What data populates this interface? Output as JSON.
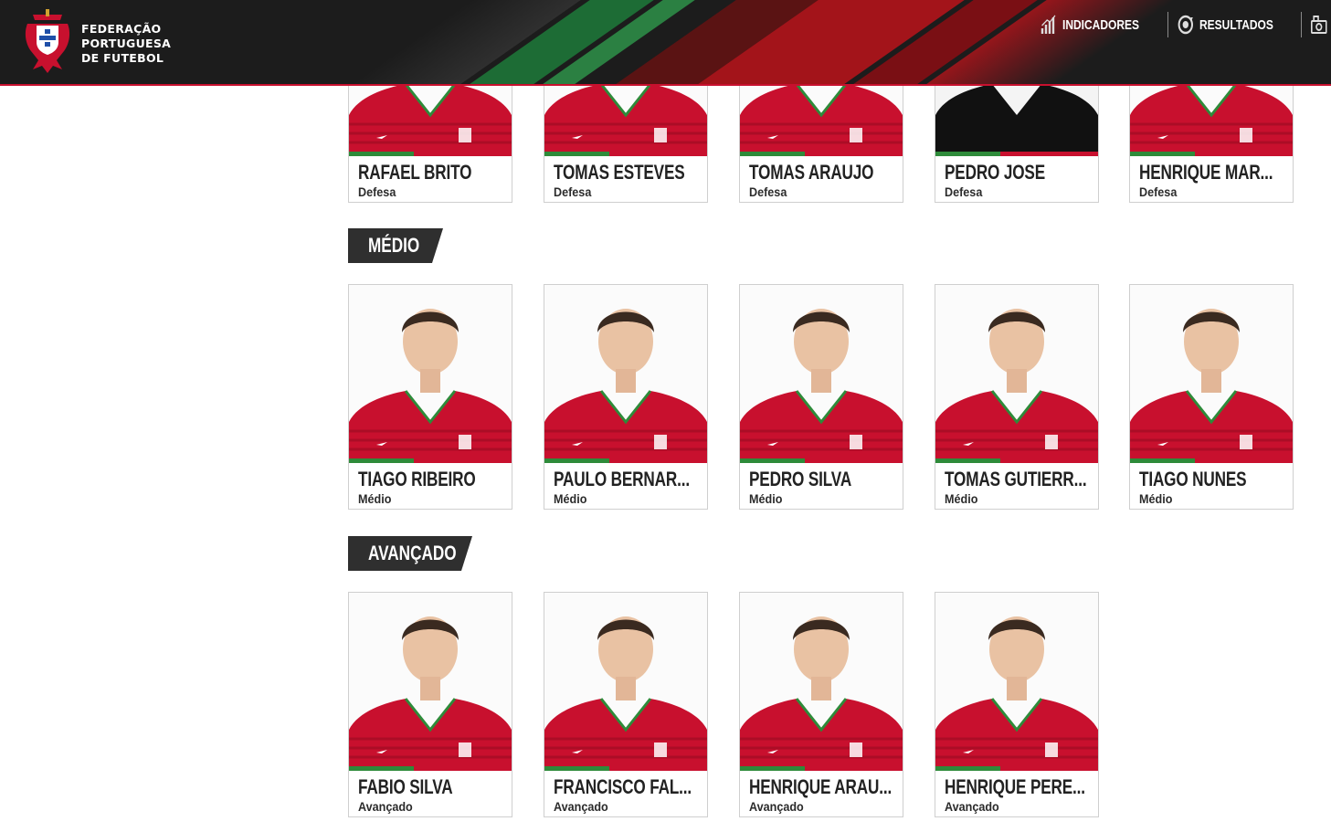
{
  "header": {
    "brand_lines": [
      "FEDERAÇÃO",
      "PORTUGUESA",
      "DE FUTEBOL"
    ],
    "nav": [
      {
        "label": "INDICADORES",
        "icon": "bar-chart-icon"
      },
      {
        "label": "RESULTADOS",
        "icon": "ball-refresh-icon"
      },
      {
        "label": "",
        "icon": "camera-icon"
      }
    ]
  },
  "colors": {
    "accent_red": "#c8102e",
    "accent_green": "#2e8b3a",
    "header_bg": "#1c1c1c",
    "section_bg": "#2f2f2f"
  },
  "sections": [
    {
      "title": "",
      "players": [
        {
          "name": "RAFAEL BRITO",
          "position": "Defesa"
        },
        {
          "name": "TOMAS ESTEVES",
          "position": "Defesa"
        },
        {
          "name": "TOMAS ARAUJO",
          "position": "Defesa"
        },
        {
          "name": "PEDRO JOSE",
          "position": "Defesa"
        },
        {
          "name": "HENRIQUE MAR...",
          "position": "Defesa"
        }
      ]
    },
    {
      "title": "MÉDIO",
      "players": [
        {
          "name": "TIAGO RIBEIRO",
          "position": "Médio"
        },
        {
          "name": "PAULO BERNAR...",
          "position": "Médio"
        },
        {
          "name": "PEDRO SILVA",
          "position": "Médio"
        },
        {
          "name": "TOMAS GUTIERR...",
          "position": "Médio"
        },
        {
          "name": "TIAGO NUNES",
          "position": "Médio"
        }
      ]
    },
    {
      "title": "AVANÇADO",
      "players": [
        {
          "name": "FABIO SILVA",
          "position": "Avançado"
        },
        {
          "name": "FRANCISCO FAL...",
          "position": "Avançado"
        },
        {
          "name": "HENRIQUE ARAU...",
          "position": "Avançado"
        },
        {
          "name": "HENRIQUE PERE...",
          "position": "Avançado"
        }
      ]
    }
  ]
}
